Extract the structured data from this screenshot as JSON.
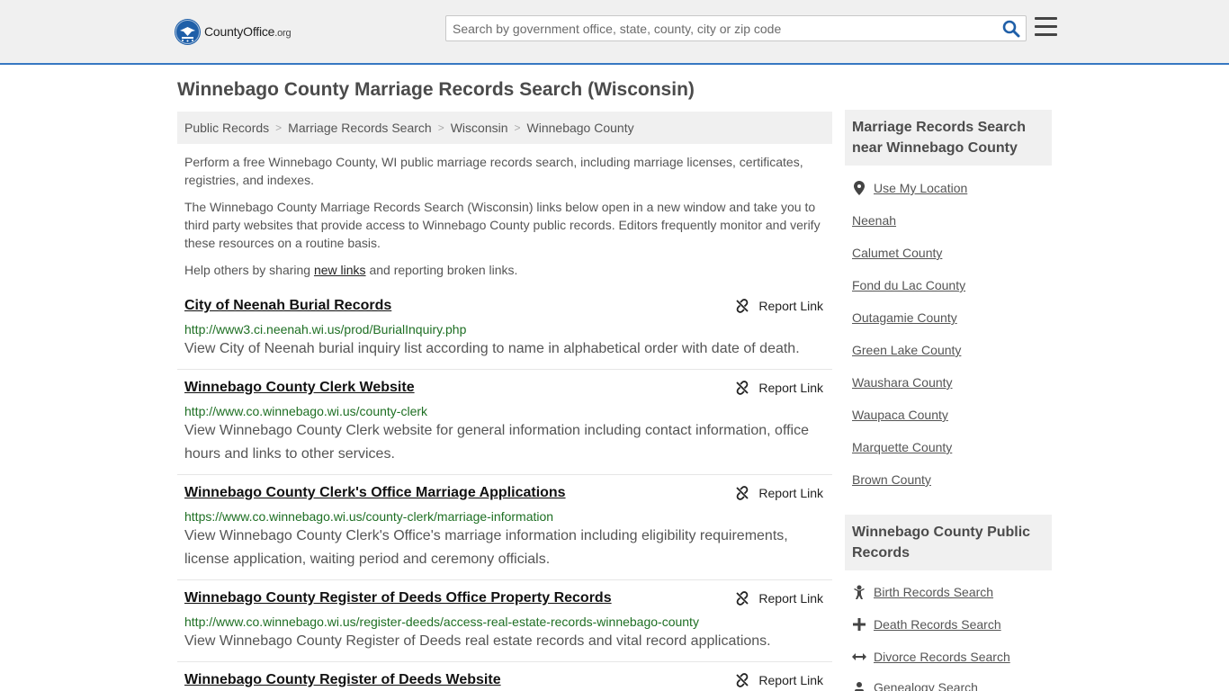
{
  "header": {
    "logo_brand": "CountyOffice",
    "logo_tld": ".org",
    "search_placeholder": "Search by government office, state, county, city or zip code"
  },
  "page": {
    "title": "Winnebago County Marriage Records Search (Wisconsin)"
  },
  "breadcrumb": [
    "Public Records",
    "Marriage Records Search",
    "Wisconsin",
    "Winnebago County"
  ],
  "intro": {
    "p1": "Perform a free Winnebago County, WI public marriage records search, including marriage licenses, certificates, registries, and indexes.",
    "p2": "The Winnebago County Marriage Records Search (Wisconsin) links below open in a new window and take you to third party websites that provide access to Winnebago County public records. Editors frequently monitor and verify these resources on a routine basis.",
    "p3_before": "Help others by sharing ",
    "p3_link": "new links",
    "p3_after": " and reporting broken links."
  },
  "report_label": "Report Link",
  "results": [
    {
      "title": "City of Neenah Burial Records",
      "url": "http://www3.ci.neenah.wi.us/prod/BurialInquiry.php",
      "desc": "View City of Neenah burial inquiry list according to name in alphabetical order with date of death."
    },
    {
      "title": "Winnebago County Clerk Website",
      "url": "http://www.co.winnebago.wi.us/county-clerk",
      "desc": "View Winnebago County Clerk website for general information including contact information, office hours and links to other services."
    },
    {
      "title": "Winnebago County Clerk's Office Marriage Applications",
      "url": "https://www.co.winnebago.wi.us/county-clerk/marriage-information",
      "desc": "View Winnebago County Clerk's Office's marriage information including eligibility requirements, license application, waiting period and ceremony officials."
    },
    {
      "title": "Winnebago County Register of Deeds Office Property Records",
      "url": "http://www.co.winnebago.wi.us/register-deeds/access-real-estate-records-winnebago-county",
      "desc": "View Winnebago County Register of Deeds real estate records and vital record applications."
    },
    {
      "title": "Winnebago County Register of Deeds Website",
      "url": "",
      "desc": ""
    }
  ],
  "sidebar": {
    "nearby_heading": "Marriage Records Search near Winnebago County",
    "use_location": "Use My Location",
    "nearby": [
      "Neenah",
      "Calumet County",
      "Fond du Lac County",
      "Outagamie County",
      "Green Lake County",
      "Waushara County",
      "Waupaca County",
      "Marquette County",
      "Brown County"
    ],
    "public_heading": "Winnebago County Public Records",
    "public_links": [
      "Birth Records Search",
      "Death Records Search",
      "Divorce Records Search",
      "Genealogy Search"
    ]
  }
}
